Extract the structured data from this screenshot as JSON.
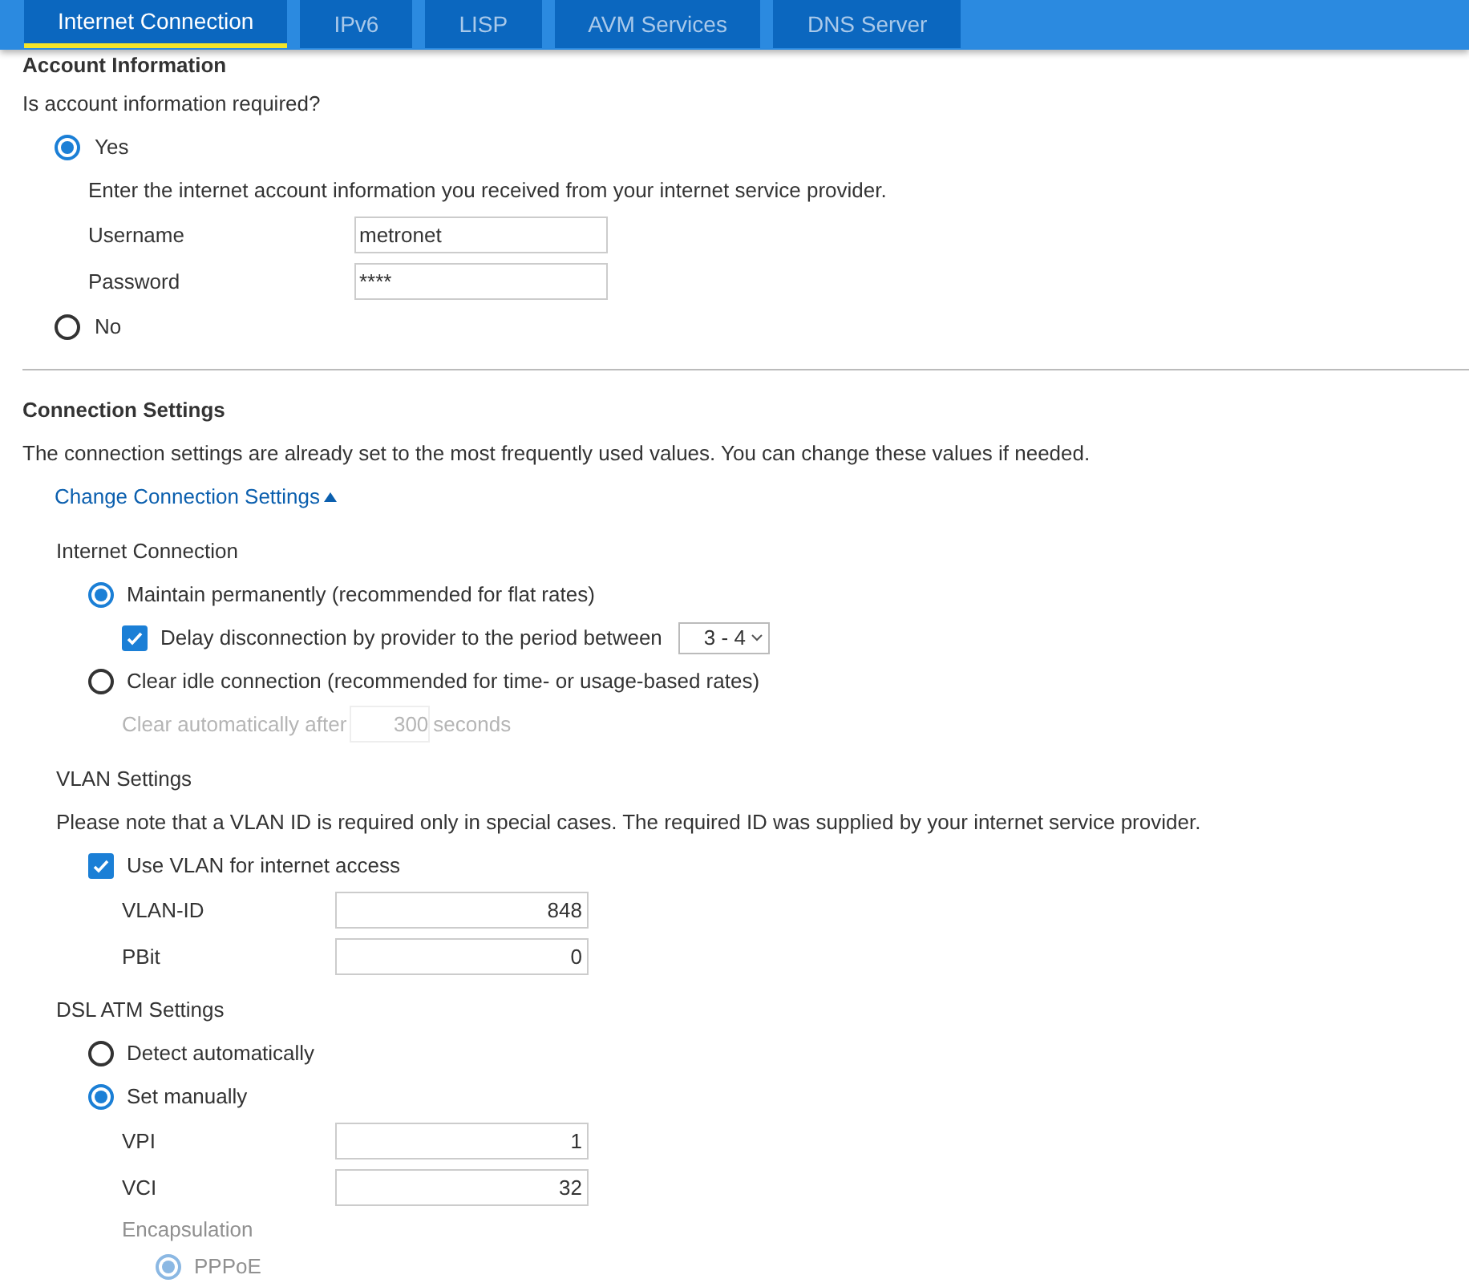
{
  "tabs": [
    {
      "label": "Internet Connection",
      "selected": true
    },
    {
      "label": "IPv6",
      "selected": false
    },
    {
      "label": "LISP",
      "selected": false
    },
    {
      "label": "AVM Services",
      "selected": false
    },
    {
      "label": "DNS Server",
      "selected": false
    }
  ],
  "account_information": {
    "heading": "Account Information",
    "question": "Is account information required?",
    "options": [
      {
        "label": "Yes",
        "selected": true,
        "hint": "Enter the internet account information you received from your internet service provider.",
        "fields": [
          {
            "label": "Username",
            "value": "metronet"
          },
          {
            "label": "Password",
            "value": "****"
          }
        ]
      },
      {
        "label": "No",
        "selected": false
      }
    ]
  },
  "connection_settings": {
    "heading": "Connection Settings",
    "description": "The connection settings are already set to the most frequently used values. You can change these values if needed.",
    "toggle_link": {
      "label": "Change Connection Settings",
      "expanded": true
    },
    "internet_connection": {
      "heading": "Internet Connection",
      "options": [
        {
          "label": "Maintain permanently (recommended for flat rates)",
          "selected": true,
          "sub_checkbox": {
            "label": "Delay disconnection by provider to the period between",
            "checked": true,
            "select_value": "3 - 4"
          }
        },
        {
          "label": "Clear idle connection (recommended for time- or usage-based rates)",
          "selected": false,
          "auto_clear": {
            "label_before": "Clear automatically after",
            "value": "300",
            "label_after": "seconds",
            "disabled": true
          }
        }
      ]
    },
    "vlan": {
      "heading": "VLAN Settings",
      "note": "Please note that a VLAN ID is required only in special cases. The required ID was supplied by your internet service provider.",
      "checkbox": {
        "label": "Use VLAN for internet access",
        "checked": true
      },
      "fields": [
        {
          "label": "VLAN-ID",
          "value": "848"
        },
        {
          "label": "PBit",
          "value": "0"
        }
      ]
    },
    "dsl_atm": {
      "heading": "DSL ATM Settings",
      "options": [
        {
          "label": "Detect automatically",
          "selected": false
        },
        {
          "label": "Set manually",
          "selected": true
        }
      ],
      "fields": [
        {
          "label": "VPI",
          "value": "1"
        },
        {
          "label": "VCI",
          "value": "32"
        }
      ],
      "encapsulation": {
        "heading": "Encapsulation",
        "options": [
          {
            "label": "PPPoE",
            "selected": true
          }
        ]
      }
    }
  }
}
